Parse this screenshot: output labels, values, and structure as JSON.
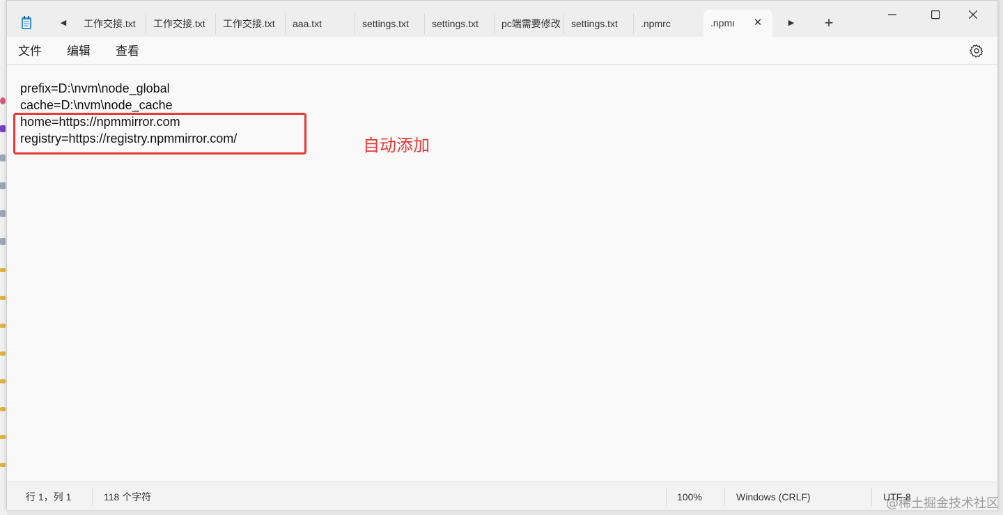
{
  "window": {
    "tabs": [
      {
        "label": "工作交接.txt"
      },
      {
        "label": "工作交接.txt"
      },
      {
        "label": "工作交接.txt"
      },
      {
        "label": "aaa.txt"
      },
      {
        "label": "settings.txt"
      },
      {
        "label": "settings.txt"
      },
      {
        "label": "pc端需要修改"
      },
      {
        "label": "settings.txt"
      },
      {
        "label": ".npmrc"
      },
      {
        "label": ".npmı"
      }
    ],
    "active_tab_index": 9
  },
  "menu": {
    "file": "文件",
    "edit": "编辑",
    "view": "查看"
  },
  "editor": {
    "lines": [
      "prefix=D:\\nvm\\node_global",
      "cache=D:\\nvm\\node_cache",
      "home=https://npmmirror.com",
      "registry=https://registry.npmmirror.com/"
    ],
    "annotation": "自动添加"
  },
  "statusbar": {
    "position": "行 1，列 1",
    "char_count": "118 个字符",
    "zoom": "100%",
    "line_ending": "Windows (CRLF)",
    "encoding": "UTF-8"
  },
  "watermark": "@稀土掘金技术社区",
  "colors": {
    "annotation": "#e53935",
    "highlight_border": "#e53935"
  },
  "icons": {
    "app": "notepad-icon",
    "scroll_left": "triangle-left-icon",
    "scroll_right": "triangle-right-icon",
    "close_tab": "close-icon",
    "new_tab": "plus-icon",
    "minimize": "minimize-icon",
    "maximize": "maximize-icon",
    "close_window": "close-icon",
    "settings": "gear-icon"
  }
}
